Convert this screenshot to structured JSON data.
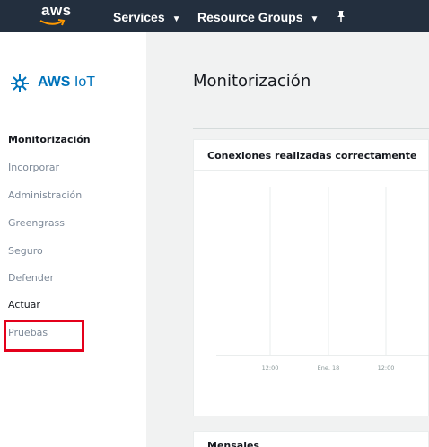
{
  "topnav": {
    "logo_text": "aws",
    "services_label": "Services",
    "resource_groups_label": "Resource Groups"
  },
  "sidebar": {
    "brand_aws": "AWS",
    "brand_iot": "IoT",
    "items": [
      {
        "label": "Monitorización"
      },
      {
        "label": "Incorporar"
      },
      {
        "label": "Administración"
      },
      {
        "label": "Greengrass"
      },
      {
        "label": "Seguro"
      },
      {
        "label": "Defender"
      },
      {
        "label": "Actuar"
      },
      {
        "label": "Pruebas"
      }
    ]
  },
  "main": {
    "title": "Monitorización",
    "cards": [
      {
        "title": "Conexiones realizadas correctamente"
      },
      {
        "title": "Mensajes"
      }
    ]
  },
  "chart_data": {
    "type": "line",
    "title": "Conexiones realizadas correctamente",
    "x_tick_labels": [
      "12:00",
      "Ene. 18",
      "12:00"
    ],
    "series": [],
    "grid": true
  },
  "colors": {
    "nav_bg": "#232f3e",
    "brand_blue": "#0073bb",
    "highlight_red": "#e4001b"
  }
}
